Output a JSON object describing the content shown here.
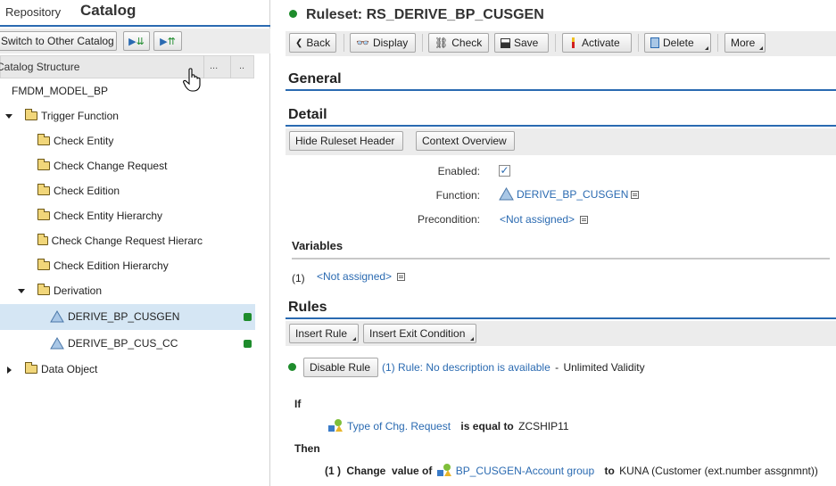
{
  "left": {
    "tabs": [
      "Repository",
      "Catalog"
    ],
    "switch_catalog": "Switch to Other Catalog",
    "structure_title": "Catalog Structure",
    "col_btn": "...",
    "col_btn2": "..",
    "root": "FMDM_MODEL_BP",
    "tree": [
      {
        "label": "Trigger Function"
      },
      {
        "label": "Check Entity"
      },
      {
        "label": "Check Change Request"
      },
      {
        "label": "Check Edition"
      },
      {
        "label": "Check Entity Hierarchy"
      },
      {
        "label": "Check Change Request Hierarc"
      },
      {
        "label": "Check Edition Hierarchy"
      },
      {
        "label": "Derivation"
      },
      {
        "label": "DERIVE_BP_CUSGEN"
      },
      {
        "label": "DERIVE_BP_CUS_CC"
      },
      {
        "label": "Data Object"
      }
    ]
  },
  "header": {
    "title": "Ruleset: RS_DERIVE_BP_CUSGEN",
    "status_color": "#1e8c2c"
  },
  "toolbar": {
    "back": "Back",
    "display": "Display",
    "check": "Check",
    "save": "Save",
    "activate": "Activate",
    "delete": "Delete",
    "more": "More"
  },
  "general": {
    "title": "General"
  },
  "detail": {
    "title": "Detail",
    "hide_header": "Hide Ruleset Header",
    "context": "Context Overview",
    "enabled_label": "Enabled:",
    "enabled": true,
    "function_label": "Function:",
    "function_value": "DERIVE_BP_CUSGEN",
    "precondition_label": "Precondition:",
    "precondition_value": "<Not assigned>"
  },
  "variables": {
    "title": "Variables",
    "index": "(1)",
    "value": "<Not assigned>"
  },
  "rules": {
    "title": "Rules",
    "insert_rule": "Insert Rule",
    "insert_exit": "Insert Exit Condition",
    "disable": "Disable Rule",
    "rule_link": "(1) Rule: No description is available",
    "rule_dash": "-",
    "validity": "Unlimited Validity",
    "if": "If",
    "cond_field": "Type of Chg. Request",
    "cond_op": "is equal to",
    "cond_value": "ZCSHIP11",
    "then": "Then",
    "action_index": "(1 )",
    "action_verb": "Change  value of",
    "action_field": "BP_CUSGEN-Account group",
    "action_to": "to",
    "action_value": "KUNA (Customer (ext.number assgnmnt))"
  }
}
